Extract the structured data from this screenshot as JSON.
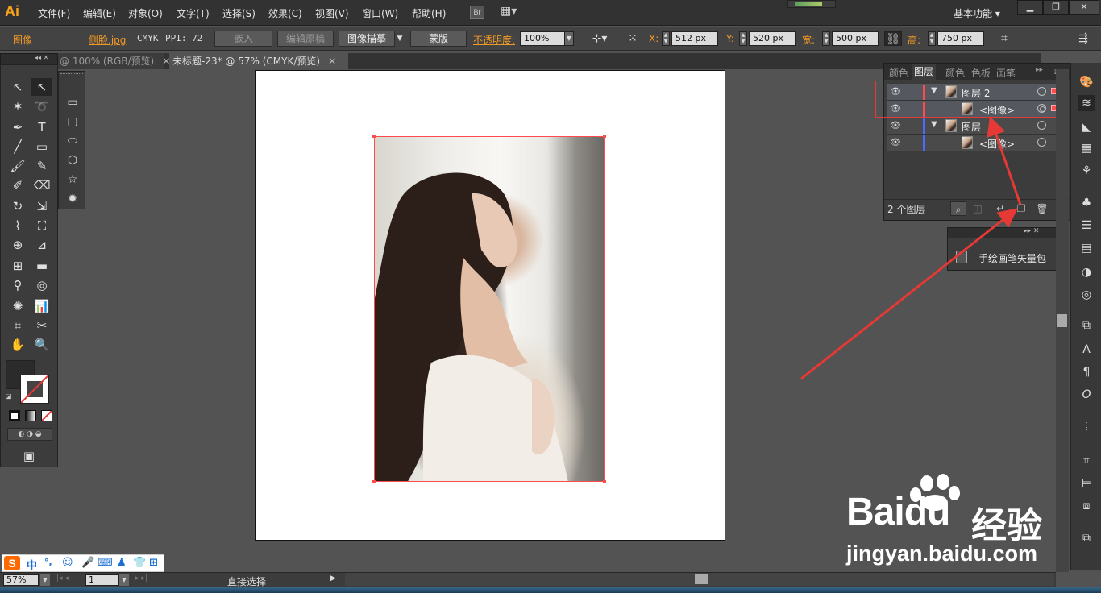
{
  "app": {
    "logo": "Ai",
    "workspace": "基本功能 ▾"
  },
  "menu": [
    "文件(F)",
    "编辑(E)",
    "对象(O)",
    "文字(T)",
    "选择(S)",
    "效果(C)",
    "视图(V)",
    "窗口(W)",
    "帮助(H)"
  ],
  "menu_extra": {
    "bridge": "Br",
    "arrange": "▦▾"
  },
  "window_buttons": {
    "minimize": "▁",
    "restore": "❐",
    "close": "✕"
  },
  "control_bar": {
    "object_type": "图像",
    "file_name": "侧脸.jpg",
    "color_mode": "CMYK",
    "ppi": "PPI: 72",
    "embed_button": "嵌入",
    "edit_original_button": "编辑原稿",
    "image_trace_button": "图像描摹",
    "mask_button": "蒙版",
    "opacity_label": "不透明度:",
    "opacity_value": "100%",
    "x_label": "X:",
    "x_value": "512 px",
    "y_label": "Y:",
    "y_value": "520 px",
    "w_label": "宽:",
    "w_value": "500 px",
    "h_label": "高:",
    "h_value": "750 px"
  },
  "tabs": [
    {
      "label": "@ 100% (RGB/预览)",
      "active": false
    },
    {
      "label": "未标题-23* @ 57% (CMYK/预览)",
      "active": true
    }
  ],
  "tab_close": "✕",
  "layers_panel": {
    "tabs": [
      "颜色",
      "图层",
      "颜色",
      "色板",
      "画笔"
    ],
    "active_tab": "图层",
    "rows": [
      {
        "name": "图层 2",
        "expanded": true,
        "indent": 0,
        "color": "#ff4b4b",
        "selected": true
      },
      {
        "name": "<图像>",
        "expanded": null,
        "indent": 1,
        "color": "#ff4b4b",
        "selected": true
      },
      {
        "name": "图层",
        "expanded": true,
        "indent": 0,
        "color": "#4b6bff",
        "selected": false
      },
      {
        "name": "<图像>",
        "expanded": null,
        "indent": 1,
        "color": "#4b6bff",
        "selected": false
      }
    ],
    "footer_count": "2 个图层"
  },
  "brush_panel": {
    "item": "手绘画笔矢量包"
  },
  "status_bar": {
    "zoom": "57%",
    "page": "1",
    "tool": "直接选择"
  },
  "ime": {
    "brand": "S",
    "mode": "中",
    "punct": "°,"
  },
  "watermark": {
    "logo": "Baidu",
    "logo_cn": "经验",
    "url": "jingyan.baidu.com"
  },
  "colors": {
    "accent": "#f39a26",
    "selection": "#ff4b4b",
    "arrow": "#e53935"
  }
}
